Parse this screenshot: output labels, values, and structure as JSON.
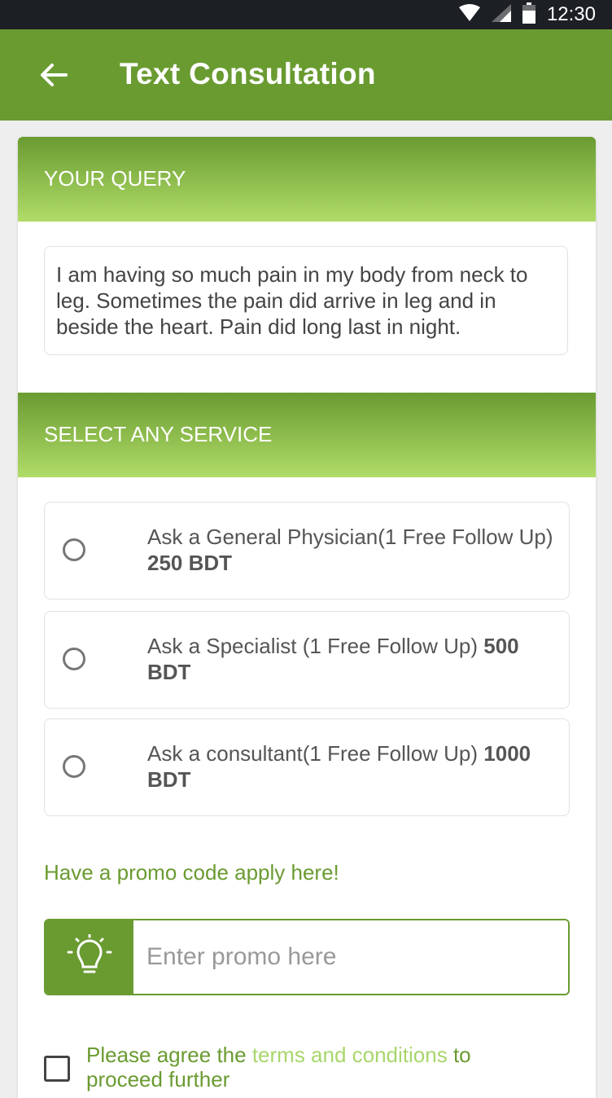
{
  "status_bar": {
    "time": "12:30",
    "icons": [
      "wifi-icon",
      "signal-icon",
      "battery-icon"
    ]
  },
  "app_bar": {
    "title": "Text Consultation",
    "back_icon": "arrow-left-icon"
  },
  "query_section": {
    "title": "YOUR QUERY",
    "query_text": "I am having so much pain in my body from neck to leg. Sometimes the pain did arrive in leg and in beside the heart. Pain did long last in night."
  },
  "service_section": {
    "title": "SELECT ANY SERVICE",
    "options": [
      {
        "label": "Ask a General Physician(1 Free Follow Up)",
        "price": "250 BDT",
        "selected": false
      },
      {
        "label": "Ask a Specialist (1 Free Follow Up)",
        "price": "500 BDT",
        "selected": false
      },
      {
        "label": "Ask a consultant(1 Free Follow Up)",
        "price": "1000 BDT",
        "selected": false
      }
    ]
  },
  "promo": {
    "label": "Have a promo code apply here!",
    "placeholder": "Enter promo here",
    "value": "",
    "icon": "lightbulb-icon"
  },
  "terms": {
    "prefix": "Please agree the ",
    "link_text": "terms and conditions",
    "suffix": " to proceed further",
    "checked": false
  },
  "colors": {
    "primary": "#6a9b31",
    "gradient_light": "#b0dc68",
    "link": "#a8d66b",
    "status_bar": "#1c1f24"
  }
}
